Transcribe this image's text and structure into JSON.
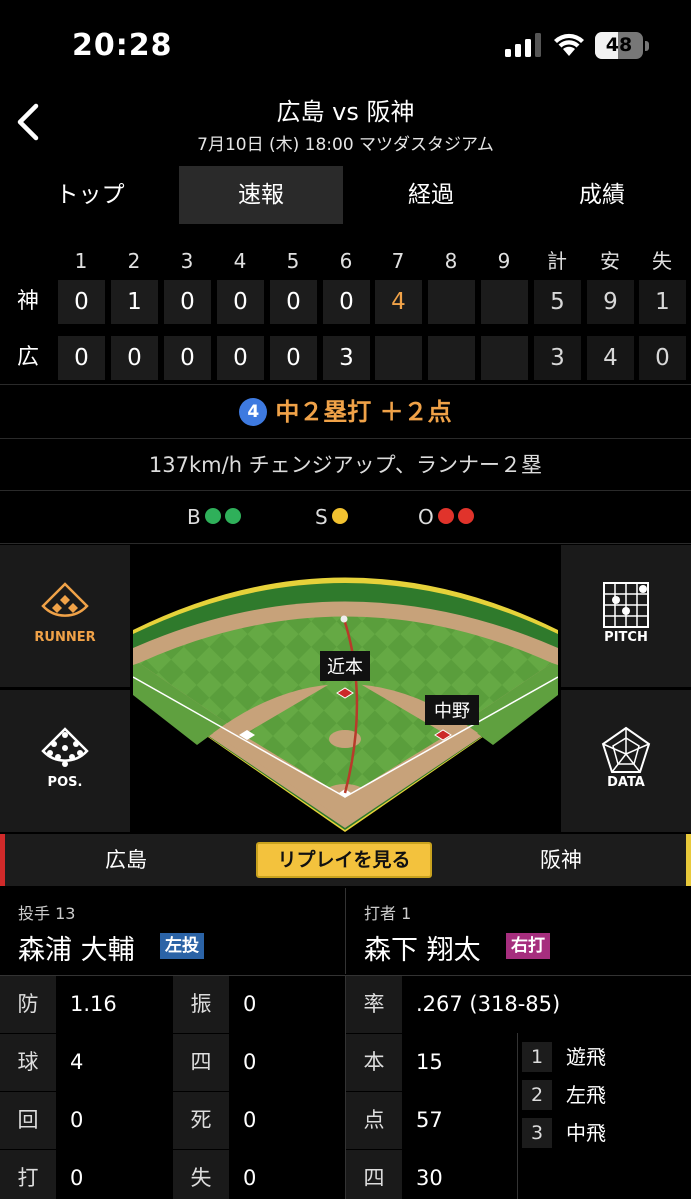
{
  "status": {
    "time": "20:28",
    "battery": "48",
    "battery_level": 0.48
  },
  "header": {
    "title": "広島 vs 阪神",
    "subtitle": "7月10日 (木) 18:00 マツダスタジアム"
  },
  "tabs": [
    {
      "label": "トップ",
      "active": false
    },
    {
      "label": "速報",
      "active": true
    },
    {
      "label": "経過",
      "active": false
    },
    {
      "label": "成績",
      "active": false
    }
  ],
  "scoreboard": {
    "headers": [
      "1",
      "2",
      "3",
      "4",
      "5",
      "6",
      "7",
      "8",
      "9",
      "計",
      "安",
      "失"
    ],
    "teams": [
      {
        "abbr": "神",
        "innings": [
          "0",
          "1",
          "0",
          "0",
          "0",
          "0",
          "4",
          "",
          "",
          ""
        ],
        "totals": [
          "5",
          "9",
          "1"
        ]
      },
      {
        "abbr": "広",
        "innings": [
          "0",
          "0",
          "0",
          "0",
          "0",
          "3",
          "",
          "",
          "",
          ""
        ],
        "totals": [
          "3",
          "4",
          "0"
        ]
      }
    ],
    "highlight_color": "#f0a248"
  },
  "play": {
    "number": "4",
    "result": "中２塁打 ＋２点",
    "description": "137km/h チェンジアップ、ランナー２塁"
  },
  "count": {
    "balls_label": "B",
    "balls": 2,
    "ball_color": "#2fb05a",
    "strikes_label": "S",
    "strikes": 1,
    "strike_color": "#f2c230",
    "outs_label": "O",
    "outs": 2,
    "out_color": "#e0332b"
  },
  "field": {
    "runner_label": "RUNNER",
    "pitch_label": "PITCH",
    "pos_label": "POS.",
    "data_label": "DATA",
    "fielder_1": "近本",
    "fielder_2": "中野"
  },
  "teambar": {
    "left_team": "広島",
    "replay": "リプレイを見る",
    "right_team": "阪神"
  },
  "pitcher": {
    "role": "投手 13",
    "name": "森浦 大輔",
    "badge": "左投",
    "badge_color": "#2b63a6"
  },
  "batter": {
    "role": "打者 1",
    "name": "森下 翔太",
    "badge": "右打",
    "badge_color": "#a62e7e"
  },
  "pitcher_stats": [
    {
      "k1": "防",
      "v1": "1.16",
      "k2": "振",
      "v2": "0"
    },
    {
      "k1": "球",
      "v1": "4",
      "k2": "四",
      "v2": "0"
    },
    {
      "k1": "回",
      "v1": "0",
      "k2": "死",
      "v2": "0"
    },
    {
      "k1": "打",
      "v1": "0",
      "k2": "失",
      "v2": "0"
    }
  ],
  "batter_stats": [
    {
      "k": "率",
      "v": ".267 (318-85)"
    },
    {
      "k": "本",
      "v": "15"
    },
    {
      "k": "点",
      "v": "57"
    },
    {
      "k": "四",
      "v": "30"
    }
  ],
  "at_bat_history": [
    {
      "n": "1",
      "result": "遊飛"
    },
    {
      "n": "2",
      "result": "左飛"
    },
    {
      "n": "3",
      "result": "中飛"
    }
  ]
}
